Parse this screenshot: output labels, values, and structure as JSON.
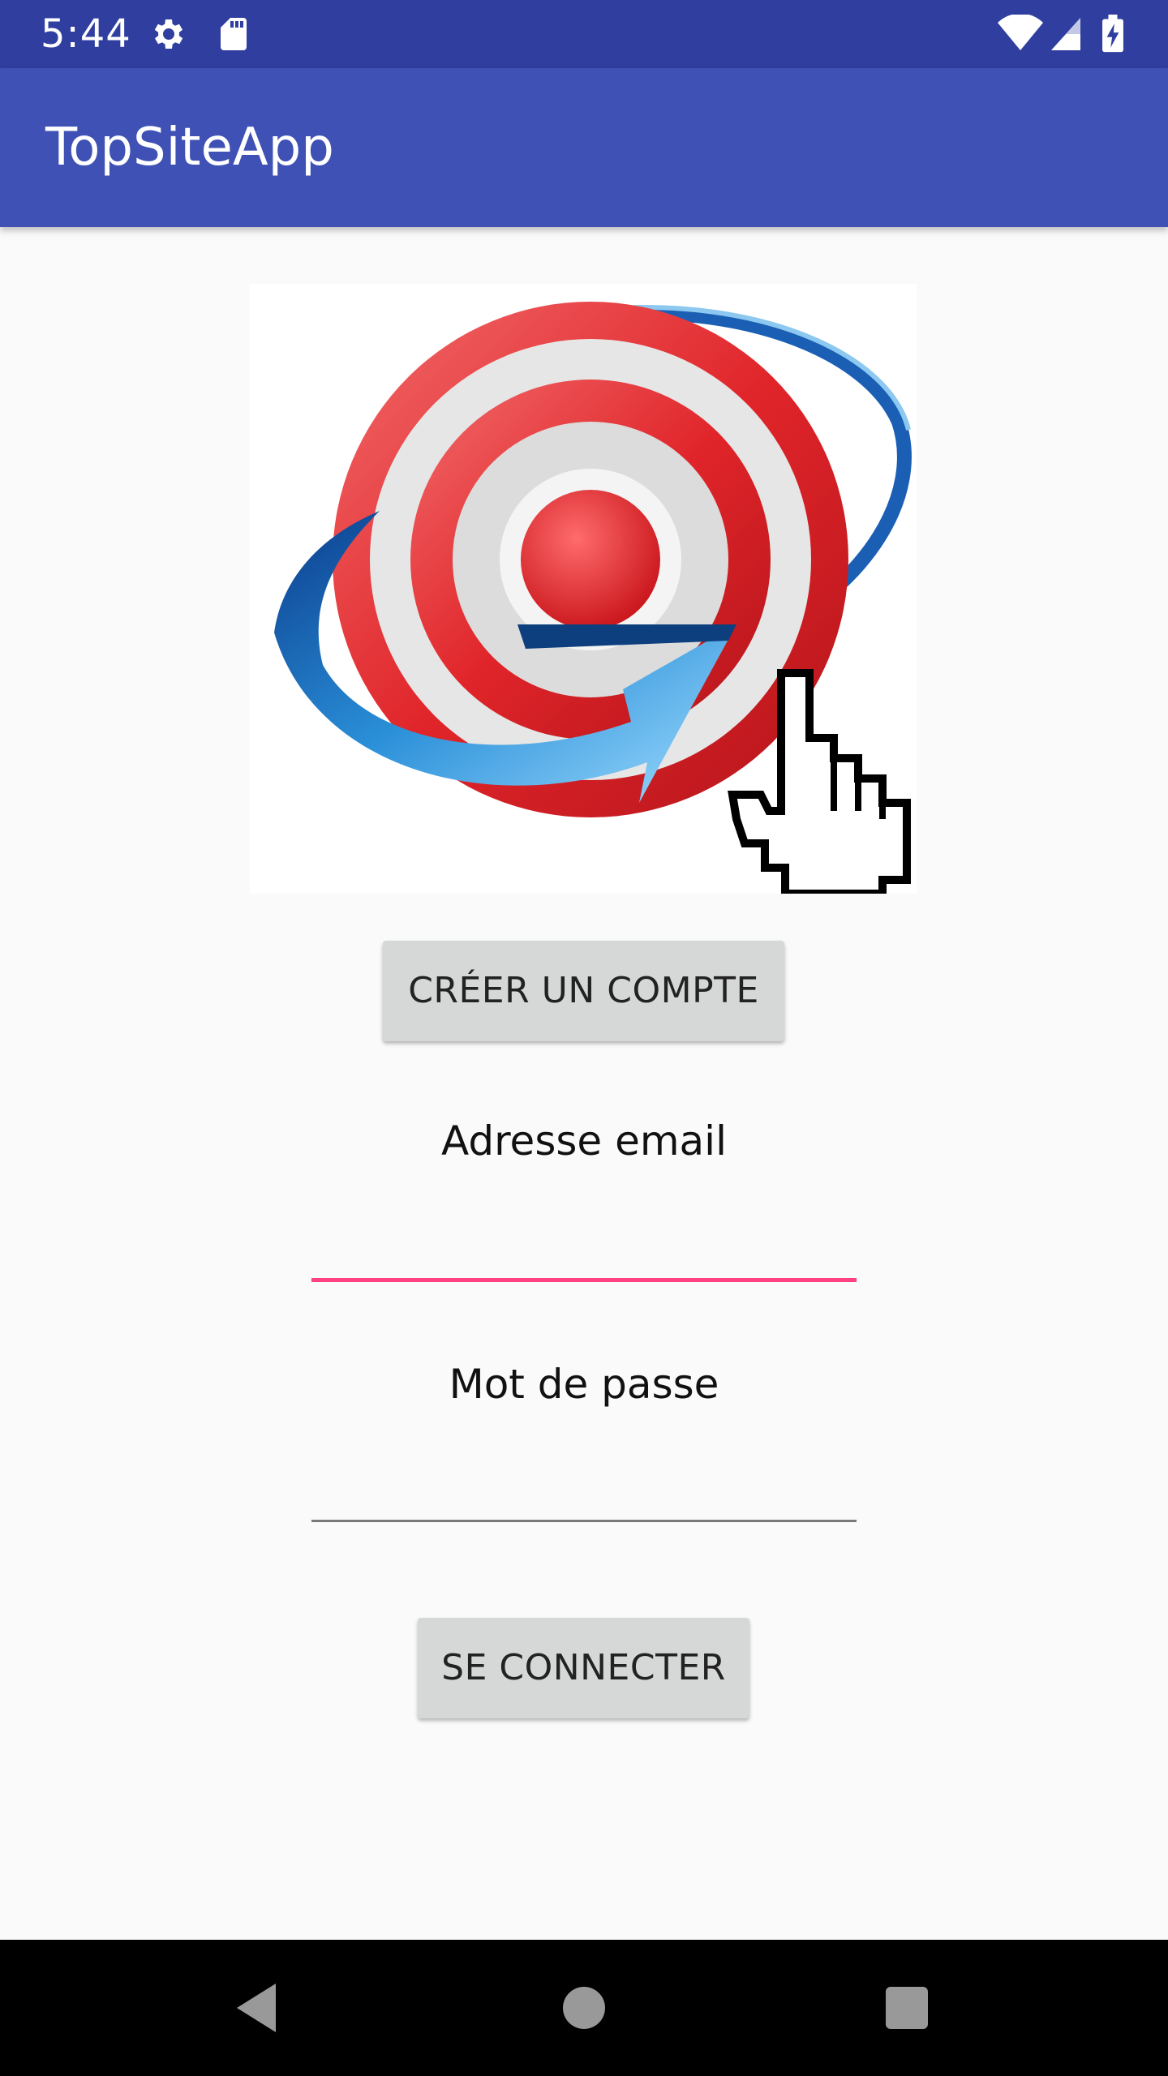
{
  "status_bar": {
    "time": "5:44",
    "icons": [
      "settings-gear-icon",
      "sd-card-icon",
      "wifi-icon",
      "cellular-signal-icon",
      "battery-charging-icon"
    ]
  },
  "app_bar": {
    "title": "TopSiteApp"
  },
  "logo": {
    "icon": "target-bullseye-arrow-hand-cursor-logo"
  },
  "buttons": {
    "create_account": "CRÉER UN COMPTE",
    "login": "SE CONNECTER"
  },
  "form": {
    "email_label": "Adresse email",
    "email_value": "",
    "password_label": "Mot de passe",
    "password_value": ""
  },
  "colors": {
    "status_bar": "#303f9f",
    "app_bar": "#3f51b5",
    "accent": "#ff4081",
    "button": "#d6d7d7"
  },
  "nav_bar": {
    "icons": [
      "back-triangle-icon",
      "home-circle-icon",
      "recents-square-icon"
    ]
  }
}
